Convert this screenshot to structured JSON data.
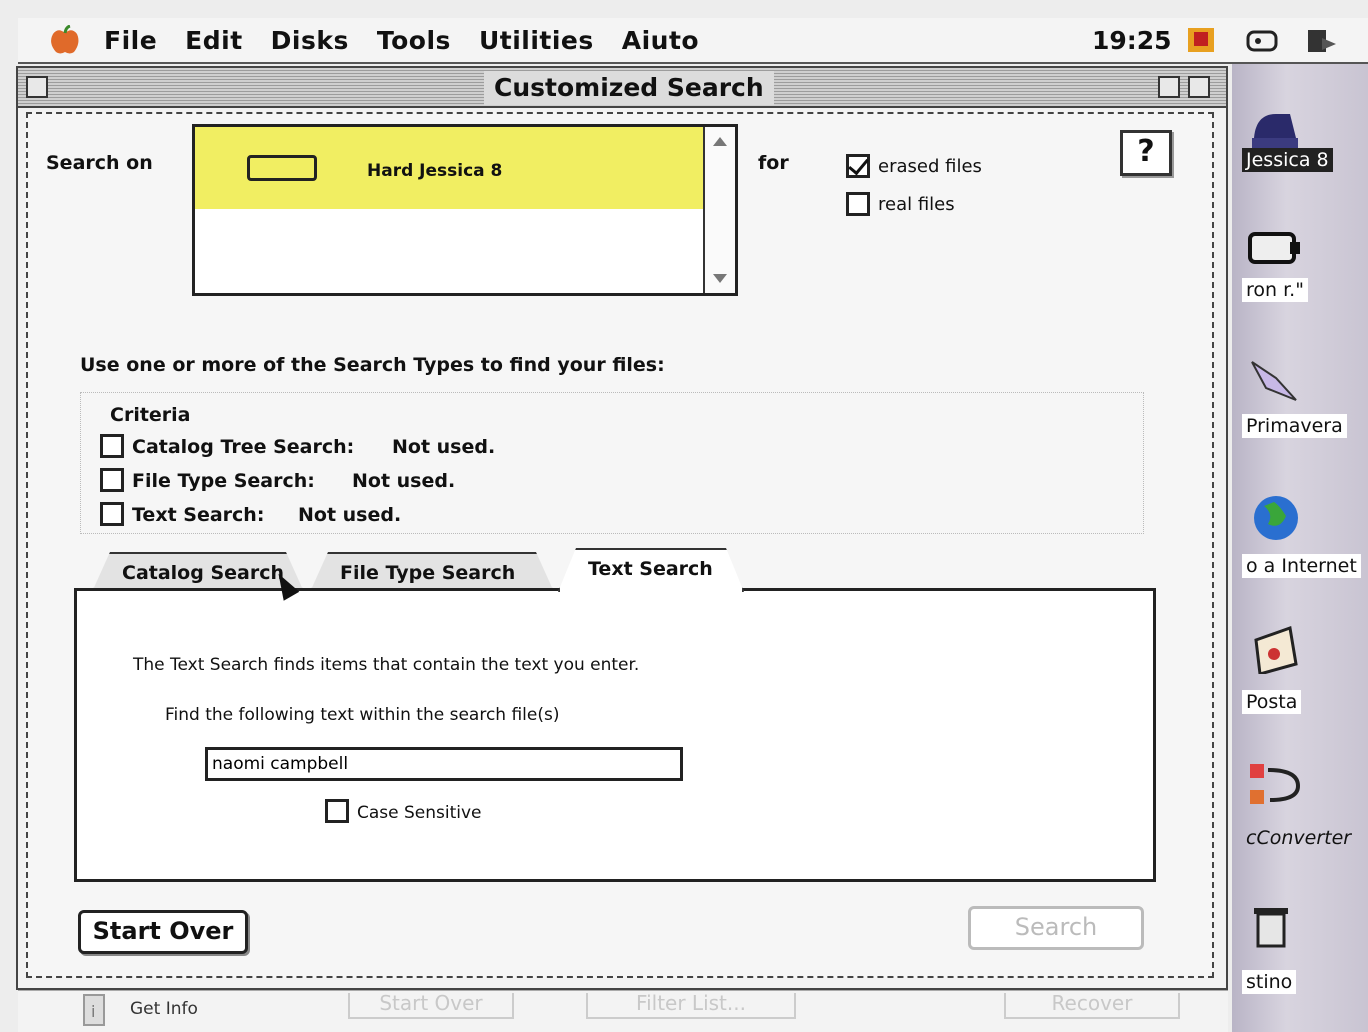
{
  "menubar": {
    "items": [
      "File",
      "Edit",
      "Disks",
      "Tools",
      "Utilities",
      "Aiuto"
    ],
    "clock": "19:25"
  },
  "window": {
    "title": "Customized Search",
    "search_on_label": "Search on",
    "volumes": [
      {
        "name": "Hard Jessica 8",
        "selected": true
      }
    ],
    "for_label": "for",
    "options": [
      {
        "label": "erased files",
        "checked": true
      },
      {
        "label": "real files",
        "checked": false
      }
    ],
    "help_label": "?",
    "instruction": "Use one or more of the Search Types to find your files:",
    "criteria_heading": "Criteria",
    "criteria": [
      {
        "name": "Catalog Tree Search:",
        "status": "Not used."
      },
      {
        "name": "File Type Search:",
        "status": "Not used."
      },
      {
        "name": "Text Search:",
        "status": "Not used."
      }
    ],
    "tabs": [
      {
        "label": "Catalog Search",
        "active": false
      },
      {
        "label": "File Type Search",
        "active": false
      },
      {
        "label": "Text Search",
        "active": true
      }
    ],
    "text_search": {
      "description": "The Text Search finds items that contain the text you enter.",
      "prompt": "Find the following text within the search file(s)",
      "query": "naomi campbell",
      "case_sensitive_label": "Case Sensitive",
      "case_sensitive": false
    },
    "start_over_label": "Start Over",
    "search_label": "Search"
  },
  "background": {
    "get_info_label": "Get Info",
    "ghost_buttons": [
      "Start Over",
      "Filter List...",
      "Recover"
    ]
  },
  "desktop": {
    "icons": [
      {
        "label": "Jessica 8",
        "icon": "hard-disk-icon",
        "selected": true
      },
      {
        "label": "ron r.\"",
        "icon": "removable-disk-icon"
      },
      {
        "label": "Primavera",
        "icon": "folder-icon"
      },
      {
        "label": "o a Internet",
        "icon": "globe-icon"
      },
      {
        "label": "Posta",
        "icon": "mail-icon"
      },
      {
        "label": "cConverter",
        "icon": "converter-icon"
      },
      {
        "label": "stino",
        "icon": "trash-icon"
      }
    ]
  }
}
